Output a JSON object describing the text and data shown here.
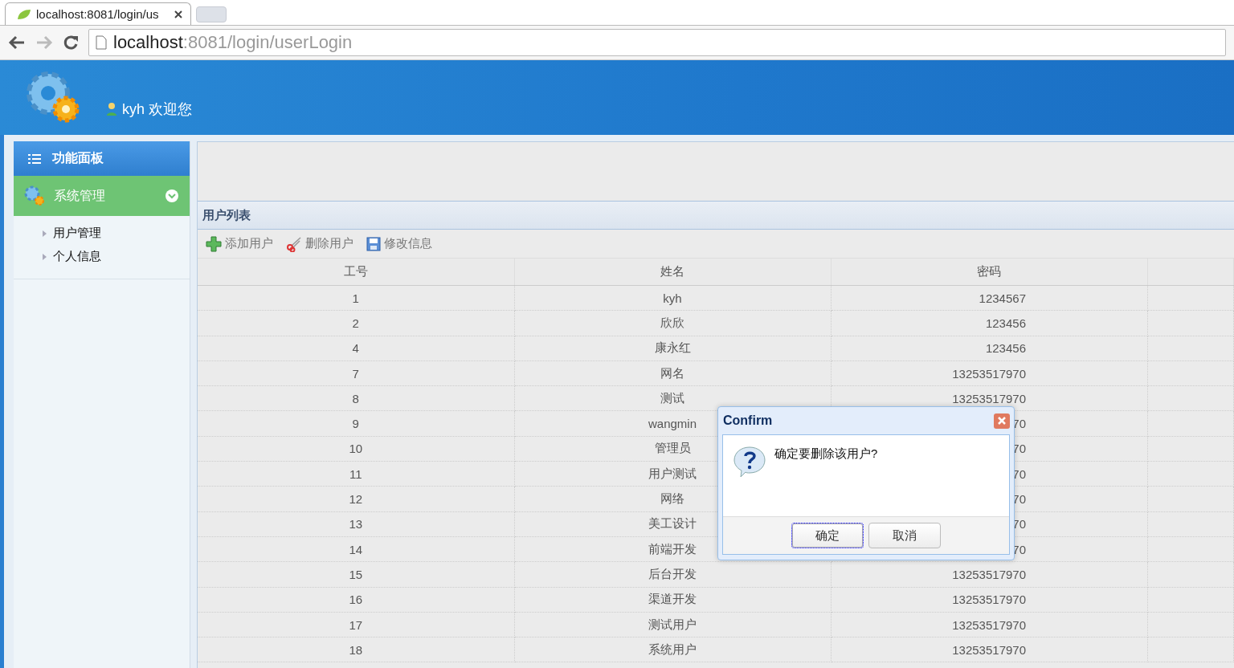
{
  "browser": {
    "tab_title": "localhost:8081/login/us",
    "url_host": "localhost",
    "url_path": ":8081/login/userLogin"
  },
  "header": {
    "greeting": "kyh 欢迎您"
  },
  "sidebar": {
    "title": "功能面板",
    "groups": [
      {
        "label": "系统管理",
        "expanded": true,
        "items": [
          {
            "label": "用户管理"
          },
          {
            "label": "个人信息"
          }
        ]
      }
    ]
  },
  "panel": {
    "title": "用户列表",
    "toolbar": [
      {
        "kind": "add",
        "label": "添加用户"
      },
      {
        "kind": "delete",
        "label": "删除用户"
      },
      {
        "kind": "save",
        "label": "修改信息"
      }
    ],
    "table": {
      "columns": [
        "工号",
        "姓名",
        "密码"
      ],
      "rows": [
        [
          "1",
          "kyh",
          "1234567"
        ],
        [
          "2",
          "欣欣",
          "123456"
        ],
        [
          "4",
          "康永红",
          "123456"
        ],
        [
          "7",
          "网名",
          "13253517970"
        ],
        [
          "8",
          "测试",
          "13253517970"
        ],
        [
          "9",
          "wangmin",
          "70"
        ],
        [
          "10",
          "管理员",
          "70"
        ],
        [
          "11",
          "用户测试",
          "70"
        ],
        [
          "12",
          "网络",
          "70"
        ],
        [
          "13",
          "美工设计",
          "70"
        ],
        [
          "14",
          "前端开发",
          "70"
        ],
        [
          "15",
          "后台开发",
          "13253517970"
        ],
        [
          "16",
          "渠道开发",
          "13253517970"
        ],
        [
          "17",
          "测试用户",
          "13253517970"
        ],
        [
          "18",
          "系统用户",
          "13253517970"
        ]
      ]
    }
  },
  "dialog": {
    "title": "Confirm",
    "message": "确定要删除该用户?",
    "buttons": [
      {
        "label": "确定",
        "focused": true
      },
      {
        "label": "取消",
        "focused": false
      }
    ]
  }
}
